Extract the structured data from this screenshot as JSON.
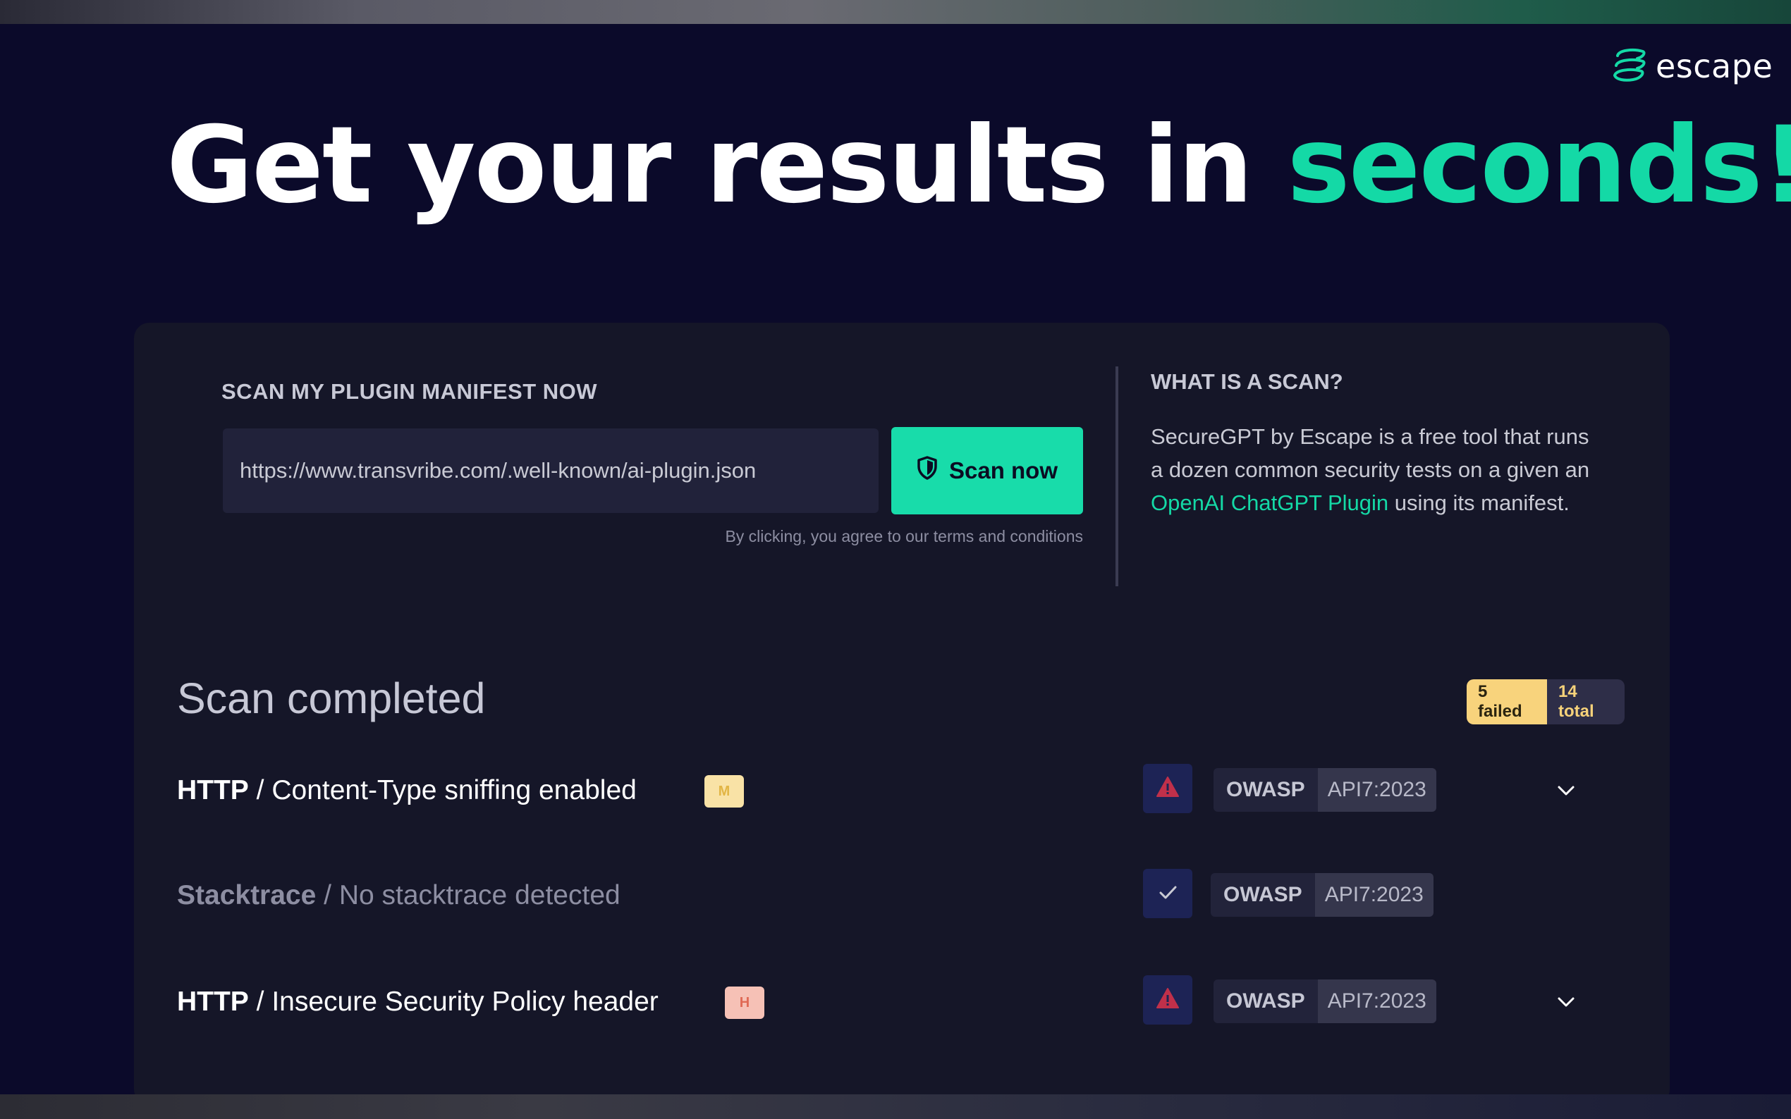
{
  "brand": {
    "logo_text": "escape",
    "icon": "escape-logo-icon"
  },
  "headline": {
    "text": "Get your results in ",
    "accent": "seconds!"
  },
  "scan_form": {
    "title": "SCAN MY PLUGIN MANIFEST NOW",
    "url_value": "https://www.transvribe.com/.well-known/ai-plugin.json",
    "button_label": "Scan now",
    "button_icon": "shield-icon",
    "terms": "By clicking, you agree to our terms and conditions"
  },
  "about": {
    "title": "WHAT IS A SCAN?",
    "desc_before": "SecureGPT by Escape is a free tool that runs a dozen common security tests on a given an ",
    "link_text": "OpenAI ChatGPT Plugin",
    "desc_after": " using its manifest."
  },
  "results": {
    "title": "Scan completed",
    "failed": "5 failed",
    "total": "14 total",
    "rows": [
      {
        "category": "HTTP",
        "separator": " / ",
        "name": "Content-Type sniffing enabled",
        "severity": "M",
        "status": "failed",
        "status_icon": "warning-icon",
        "tag": "OWASP",
        "code": "API7:2023",
        "expand_icon": "chevron-down-icon"
      },
      {
        "category": "Stacktrace",
        "separator": " / ",
        "name": "No stacktrace detected",
        "status": "passed",
        "status_icon": "check-icon",
        "tag": "OWASP",
        "code": "API7:2023"
      },
      {
        "category": "HTTP",
        "separator": " / ",
        "name": "Insecure Security Policy header",
        "severity": "H",
        "status": "failed",
        "status_icon": "warning-icon",
        "tag": "OWASP",
        "code": "API7:2023",
        "expand_icon": "chevron-down-icon"
      }
    ]
  },
  "colors": {
    "background": "#0b0a2a",
    "card": "#151628",
    "accent": "#14d9a6",
    "failed_badge": "#f8d37c",
    "medium": "#f9e2a6",
    "high": "#f6c1b6"
  }
}
